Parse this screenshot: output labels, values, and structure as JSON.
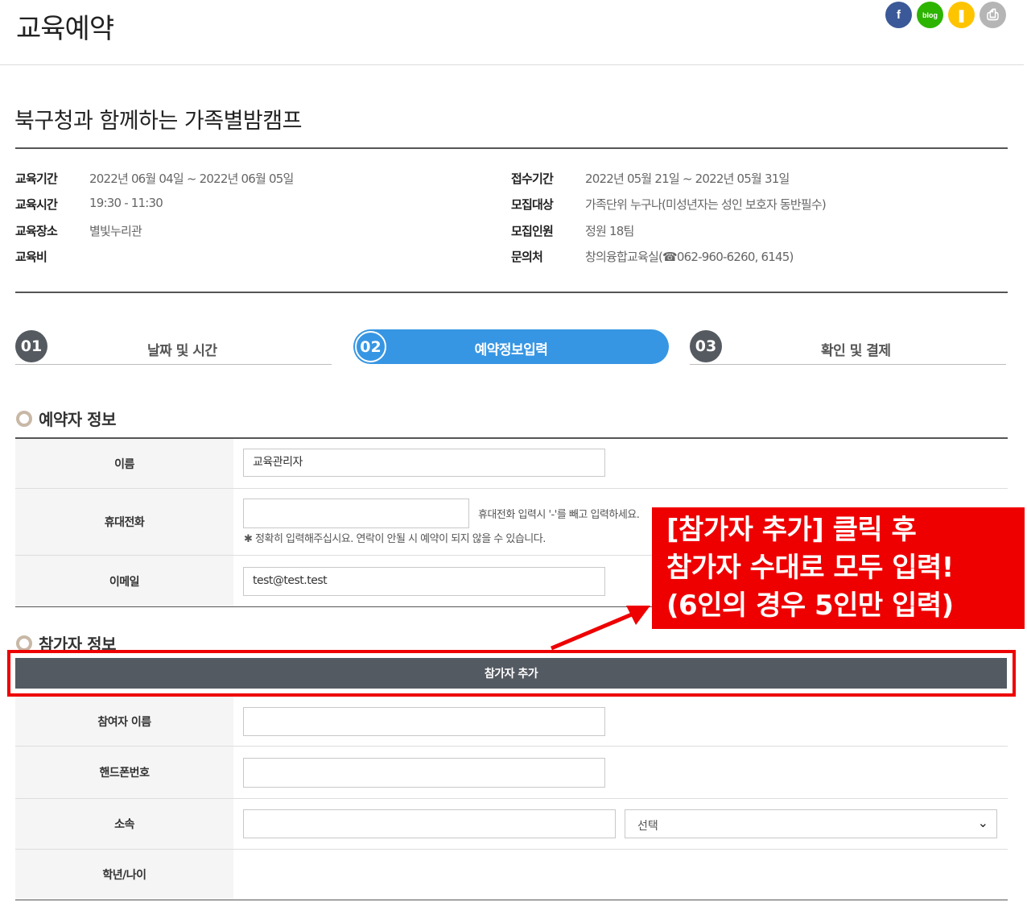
{
  "header": {
    "title": "교육예약",
    "share_icons": [
      {
        "name": "facebook-icon",
        "glyph": "f",
        "color": "#3b5998"
      },
      {
        "name": "blog-icon",
        "glyph": "blog",
        "color": "#2db400"
      },
      {
        "name": "kakaostory-icon",
        "glyph": "❚",
        "color": "#ffc400"
      },
      {
        "name": "print-icon",
        "glyph": "⎙",
        "color": "#b5b5b5"
      }
    ]
  },
  "course": {
    "title": "북구청과 함께하는 가족별밤캠프",
    "info_left": [
      {
        "key": "교육기간",
        "value": "2022년 06월 04일 ~ 2022년 06월 05일"
      },
      {
        "key": "교육시간",
        "value": "19:30 - 11:30"
      },
      {
        "key": "교육장소",
        "value": "별빛누리관"
      },
      {
        "key": "교육비",
        "value": ""
      }
    ],
    "info_right": [
      {
        "key": "접수기간",
        "value": "2022년 05월 21일 ~ 2022년 05월 31일"
      },
      {
        "key": "모집대상",
        "value": "가족단위 누구나(미성년자는 성인 보호자 동반필수)"
      },
      {
        "key": "모집인원",
        "value": "정원 18팀"
      },
      {
        "key": "문의처",
        "value": "창의융합교육실(☎062-960-6260, 6145)"
      }
    ]
  },
  "steps": [
    {
      "num": "01",
      "label": "날짜 및 시간"
    },
    {
      "num": "02",
      "label": "예약정보입력"
    },
    {
      "num": "03",
      "label": "확인 및 결제"
    }
  ],
  "reserver": {
    "heading": "예약자 정보",
    "name_label": "이름",
    "name_value": "교육관리자",
    "phone_label": "휴대전화",
    "phone_value": "",
    "phone_hint": "휴대전화 입력시 '-'를 빼고 입력하세요.",
    "phone_note": "✱ 정확히 입력해주십시요. 연락이 안될 시 예약이 되지 않을 수 있습니다.",
    "email_label": "이메일",
    "email_value": "test@test.test"
  },
  "participant": {
    "heading": "참가자 정보",
    "add_button": "참가자 추가",
    "name_label": "참여자 이름",
    "phone_label": "핸드폰번호",
    "affiliation_label": "소속",
    "affiliation_select": "선택",
    "grade_label": "학년/나이"
  },
  "annotation": {
    "lines": [
      "[참가자 추가] 클릭 후",
      "참가자 수대로 모두 입력!",
      "(6인의 경우 5인만 입력)"
    ],
    "color": "#ee0000"
  }
}
